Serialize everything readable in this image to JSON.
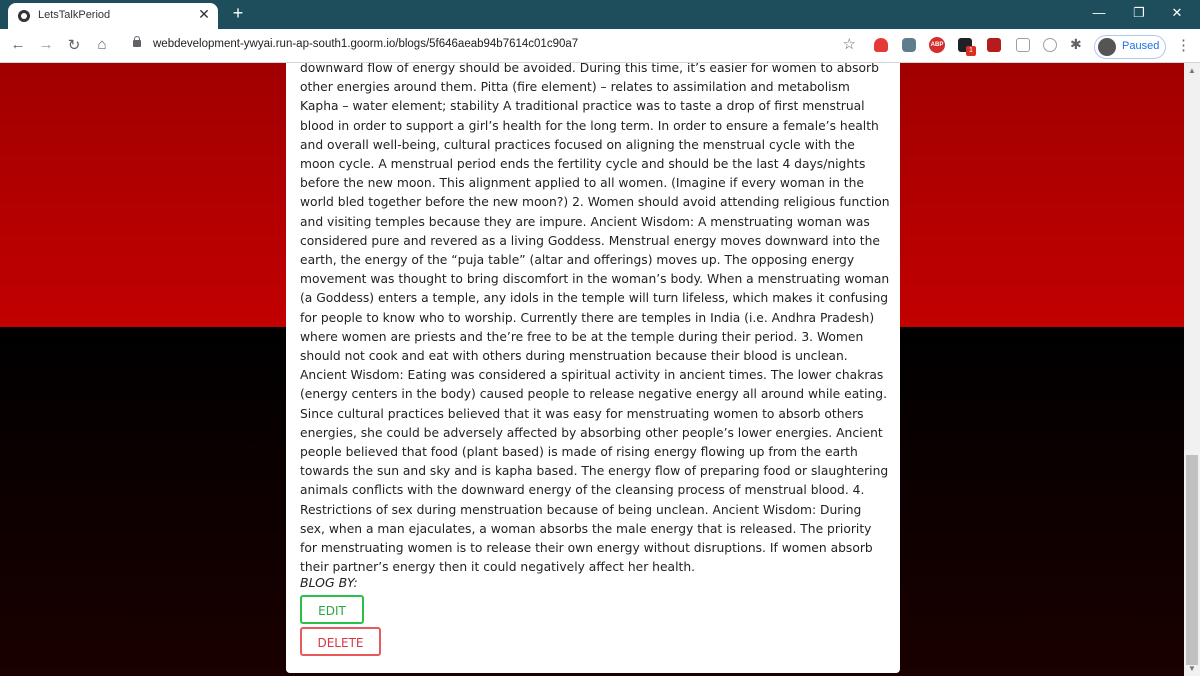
{
  "browser": {
    "tab_title": "LetsTalkPeriod",
    "tab_close": "✕",
    "new_tab": "+",
    "url": "webdevelopment-ywyai.run-ap-south1.goorm.io/blogs/5f646aeab94b7614c01c90a7",
    "profile_status": "Paused",
    "ext_abp_label": "ABP",
    "ext_badge": "1",
    "colors": {
      "tabbar": "#1e4d5c",
      "accent": "#1a73e8"
    }
  },
  "blog": {
    "content": "downward flow of energy should be avoided. During this time, it’s easier for women to absorb other energies around them. Pitta (fire element) – relates to assimilation and metabolism Kapha – water element; stability A traditional practice was to taste a drop of first menstrual blood in order to support a girl’s health for the long term. In order to ensure a female’s health and overall well-being, cultural practices focused on aligning the menstrual cycle with the moon cycle. A menstrual period ends the fertility cycle and should be the last 4 days/nights before the new moon. This alignment applied to all women. (Imagine if every woman in the world bled together before the new moon?) 2. Women should avoid attending religious function and visiting temples because they are impure. Ancient Wisdom: A menstruating woman was considered pure and revered as a living Goddess. Menstrual energy moves downward into the earth, the energy of the “puja table” (altar and offerings) moves up. The opposing energy movement was thought to bring discomfort in the woman’s body. When a menstruating woman (a Goddess) enters a temple, any idols in the temple will turn lifeless, which makes it confusing for people to know who to worship. Currently there are temples in India (i.e. Andhra Pradesh) where women are priests and the’re free to be at the temple during their period. 3. Women should not cook and eat with others during menstruation because their blood is unclean. Ancient Wisdom: Eating was considered a spiritual activity in ancient times. The lower chakras (energy centers in the body) caused people to release negative energy all around while eating. Since cultural practices believed that it was easy for menstruating women to absorb others energies, she could be adversely affected by absorbing other people’s lower energies. Ancient people believed that food (plant based) is made of rising energy flowing up from the earth towards the sun and sky and is kapha based. The energy flow of preparing food or slaughtering animals conflicts with the downward energy of the cleansing process of menstrual blood. 4. Restrictions of sex during menstruation because of being unclean. Ancient Wisdom: During sex, when a man ejaculates, a woman absorbs the male energy that is released. The priority for menstruating women is to release their own energy without disruptions. If women absorb their partner’s energy then it could negatively affect her health.",
    "blog_by_label": "BLOG BY:",
    "edit_label": "EDIT",
    "delete_label": "DELETE",
    "colors": {
      "edit": "#28a745",
      "delete": "#dc3545",
      "bg_top": "#c20000",
      "bg_bottom": "#000000"
    }
  }
}
